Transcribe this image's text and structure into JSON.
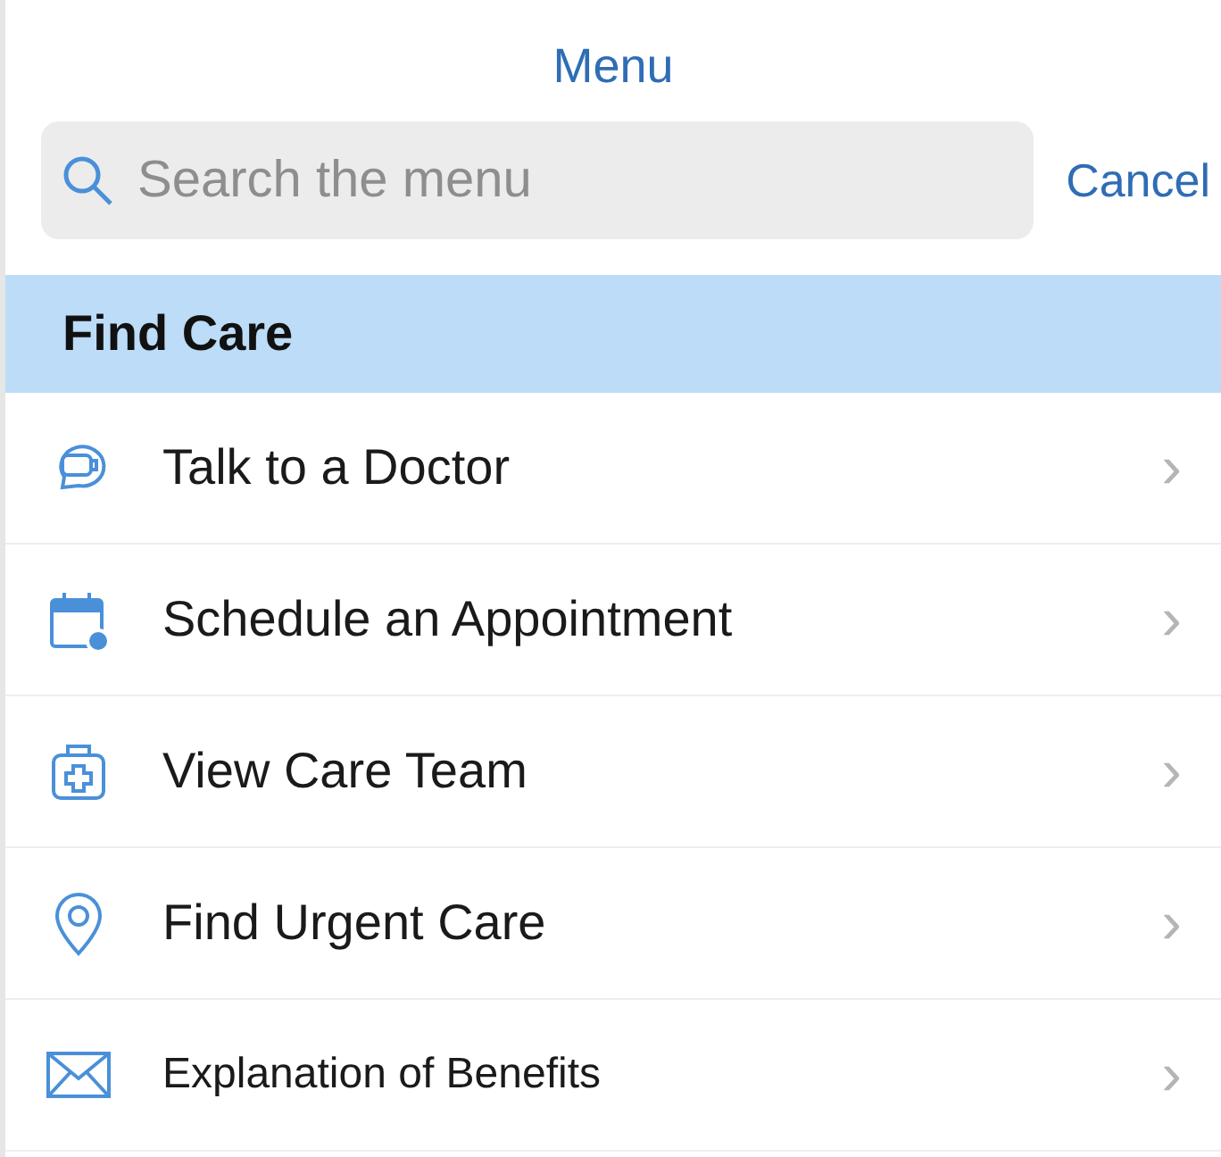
{
  "header": {
    "title": "Menu"
  },
  "search": {
    "placeholder": "Search the menu",
    "cancel": "Cancel"
  },
  "section": {
    "title": "Find Care"
  },
  "items": [
    {
      "label": "Talk to a Doctor",
      "chevron": "›"
    },
    {
      "label": "Schedule an Appointment",
      "chevron": "›"
    },
    {
      "label": "View Care Team",
      "chevron": "›"
    },
    {
      "label": "Find Urgent Care",
      "chevron": "›"
    },
    {
      "label": "Explanation of Benefits",
      "chevron": "›"
    }
  ]
}
